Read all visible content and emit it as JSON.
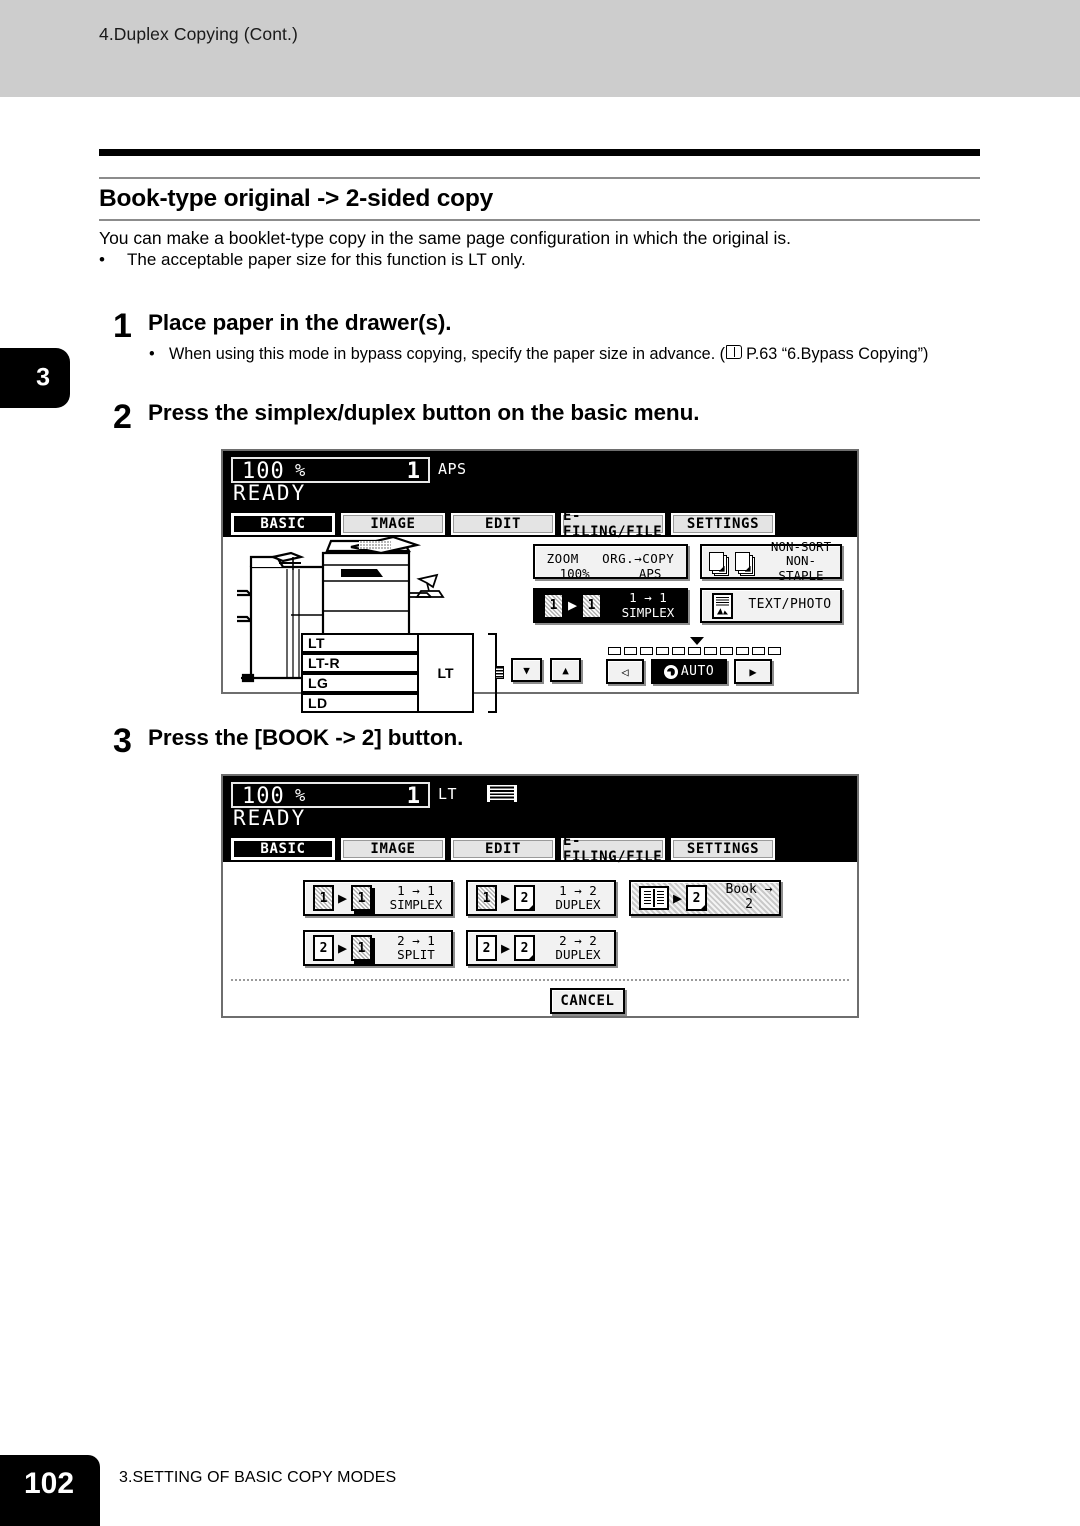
{
  "header": {
    "running_head": "4.Duplex Copying (Cont.)"
  },
  "chapter_tab": "3",
  "section": {
    "title": "Book-type original -> 2-sided copy",
    "intro": "You can make a booklet-type copy in the same page configuration in which the original is.",
    "bullet_dot": "•",
    "bullet": "The acceptable paper size for this function is LT only."
  },
  "steps": [
    {
      "number": "1",
      "title": "Place paper in the drawer(s).",
      "note_dot": "•",
      "note_before": "When using this mode in bypass copying, specify the paper size in advance. (",
      "note_after": "P.63 “6.Bypass Copying”)"
    },
    {
      "number": "2",
      "title": "Press the simplex/duplex button on the basic menu."
    },
    {
      "number": "3",
      "title": "Press the [BOOK -> 2] button."
    }
  ],
  "lcd1": {
    "zoom": "100",
    "percent": "%",
    "copies": "1",
    "paper_size": "APS",
    "status": "READY",
    "tabs": [
      {
        "label": "BASIC",
        "selected": true
      },
      {
        "label": "IMAGE",
        "selected": false
      },
      {
        "label": "EDIT",
        "selected": false
      },
      {
        "label": "E-FILING/FILE",
        "selected": false
      },
      {
        "label": "SETTINGS",
        "selected": false
      }
    ],
    "drawers": [
      {
        "label": "LT"
      },
      {
        "label": "LT-R"
      },
      {
        "label": "LG"
      },
      {
        "label": "LD"
      }
    ],
    "bypass_label": "LT",
    "zoom_button": {
      "left_top": "ZOOM",
      "right_top": "ORG.",
      "arrow": "→",
      "right_top2": "COPY",
      "left_bottom": "100%",
      "right_bottom": "APS"
    },
    "finisher_button": {
      "line1": "NON-SORT",
      "line2": "NON-STAPLE"
    },
    "duplex_button": {
      "line1": "1 → 1",
      "line2": "SIMPLEX",
      "icon_left": "1",
      "icon_right": "1"
    },
    "original_mode_button": {
      "label": "TEXT/PHOTO"
    },
    "density": {
      "segments": 11,
      "marker_index": 5,
      "left_arrow": "◁",
      "right_arrow": "▶",
      "auto_label": "AUTO"
    },
    "drawer_arrows": {
      "down": "▼",
      "up": "▲"
    }
  },
  "lcd2": {
    "zoom": "100",
    "percent": "%",
    "copies": "1",
    "paper_size": "LT",
    "status": "READY",
    "tabs": [
      {
        "label": "BASIC",
        "selected": true
      },
      {
        "label": "IMAGE",
        "selected": false
      },
      {
        "label": "EDIT",
        "selected": false
      },
      {
        "label": "E-FILING/FILE",
        "selected": false
      },
      {
        "label": "SETTINGS",
        "selected": false
      }
    ],
    "mode_buttons": [
      {
        "line1": "1 → 1",
        "line2": "SIMPLEX",
        "icon_left": "1",
        "icon_right": "1",
        "selected": false
      },
      {
        "line1": "1 → 2",
        "line2": "DUPLEX",
        "icon_left": "1",
        "icon_right": "2",
        "selected": false
      },
      {
        "line1": "Book → 2",
        "line2": "",
        "icon_left": "book",
        "icon_right": "2",
        "selected": true
      },
      {
        "line1": "2 → 1",
        "line2": "SPLIT",
        "icon_left": "2",
        "icon_right": "1",
        "selected": false
      },
      {
        "line1": "2 → 2",
        "line2": "DUPLEX",
        "icon_left": "2",
        "icon_right": "2",
        "selected": false
      }
    ],
    "cancel_label": "CANCEL"
  },
  "footer": {
    "page_number": "102",
    "chapter_title": "3.SETTING OF BASIC COPY MODES"
  }
}
